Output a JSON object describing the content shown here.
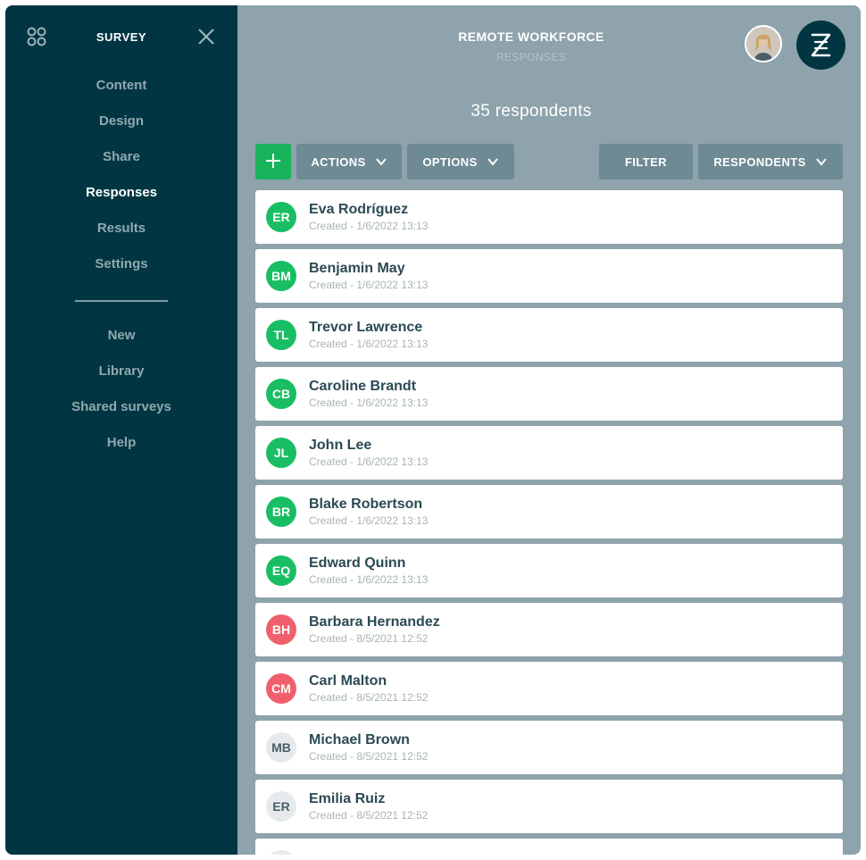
{
  "sidebar": {
    "title": "SURVEY",
    "apps_icon": "apps-grid-icon",
    "close_icon": "close-icon",
    "primary_nav": [
      {
        "label": "Content",
        "active": false
      },
      {
        "label": "Design",
        "active": false
      },
      {
        "label": "Share",
        "active": false
      },
      {
        "label": "Responses",
        "active": true
      },
      {
        "label": "Results",
        "active": false
      },
      {
        "label": "Settings",
        "active": false
      }
    ],
    "secondary_nav": [
      {
        "label": "New"
      },
      {
        "label": "Library"
      },
      {
        "label": "Shared surveys"
      },
      {
        "label": "Help"
      }
    ]
  },
  "header": {
    "title": "REMOTE WORKFORCE",
    "subtitle": "RESPONSES"
  },
  "summary": {
    "count_text": "35 respondents"
  },
  "toolbar": {
    "add_icon": "plus-icon",
    "actions_label": "ACTIONS",
    "options_label": "OPTIONS",
    "filter_label": "FILTER",
    "respondents_label": "RESPONDENTS"
  },
  "colors": {
    "sidebar_bg": "#003541",
    "main_bg": "#8ea3ab",
    "accent_green": "#18b35a",
    "complete_avatar": "#19be64",
    "partial_avatar": "#f0606c",
    "empty_avatar": "#e6eaec"
  },
  "respondents": [
    {
      "initials": "ER",
      "name": "Eva Rodríguez",
      "created": "Created - 1/6/2022 13:13",
      "status": "complete"
    },
    {
      "initials": "BM",
      "name": "Benjamin May",
      "created": "Created - 1/6/2022 13:13",
      "status": "complete"
    },
    {
      "initials": "TL",
      "name": "Trevor Lawrence",
      "created": "Created - 1/6/2022 13:13",
      "status": "complete"
    },
    {
      "initials": "CB",
      "name": "Caroline Brandt",
      "created": "Created - 1/6/2022 13:13",
      "status": "complete"
    },
    {
      "initials": "JL",
      "name": "John Lee",
      "created": "Created - 1/6/2022 13:13",
      "status": "complete"
    },
    {
      "initials": "BR",
      "name": "Blake Robertson",
      "created": "Created - 1/6/2022 13:13",
      "status": "complete"
    },
    {
      "initials": "EQ",
      "name": "Edward Quinn",
      "created": "Created - 1/6/2022 13:13",
      "status": "complete"
    },
    {
      "initials": "BH",
      "name": "Barbara Hernandez",
      "created": "Created - 8/5/2021 12:52",
      "status": "partial"
    },
    {
      "initials": "CM",
      "name": "Carl Malton",
      "created": "Created - 8/5/2021 12:52",
      "status": "partial"
    },
    {
      "initials": "MB",
      "name": "Michael Brown",
      "created": "Created - 8/5/2021 12:52",
      "status": "empty"
    },
    {
      "initials": "ER",
      "name": "Emilia Ruiz",
      "created": "Created - 8/5/2021 12:52",
      "status": "empty"
    },
    {
      "initials": "",
      "name": "",
      "created": "",
      "status": "empty"
    }
  ]
}
